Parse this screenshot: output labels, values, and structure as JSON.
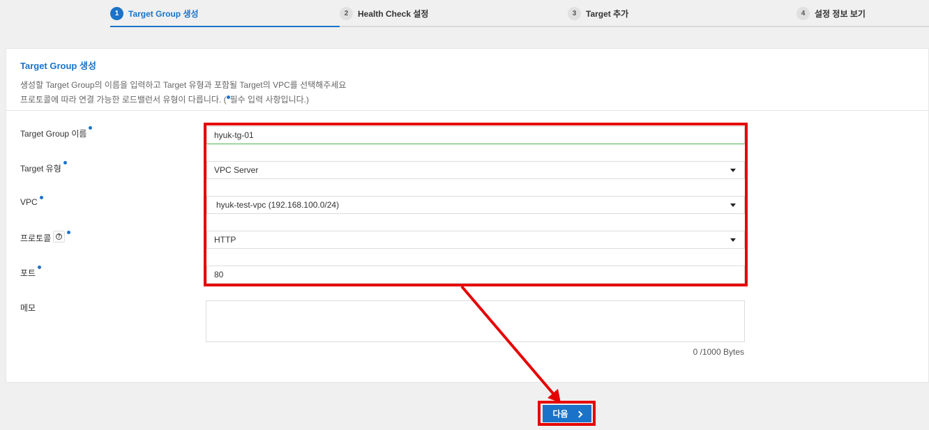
{
  "stepper": {
    "steps": [
      {
        "num": "1",
        "label": "Target Group 생성"
      },
      {
        "num": "2",
        "label": "Health Check 설정"
      },
      {
        "num": "3",
        "label": "Target 추가"
      },
      {
        "num": "4",
        "label": "설정 정보 보기"
      }
    ]
  },
  "panel": {
    "title": "Target Group 생성",
    "desc_line1": "생성할 Target Group의 이름을 입력하고 Target 유형과 포함될 Target의 VPC를 선택해주세요",
    "desc_line2_prefix": "프로토콜에 따라 연결 가능한 로드밸런서 유형이 다릅니다. (",
    "desc_line2_suffix": "필수 입력 사항입니다.)"
  },
  "form": {
    "name_label": "Target Group 이름",
    "name_value": "hyuk-tg-01",
    "type_label": "Target 유형",
    "type_value": "VPC Server",
    "vpc_label": "VPC",
    "vpc_value": "hyuk-test-vpc (192.168.100.0/24)",
    "protocol_label": "프로토콜",
    "protocol_value": "HTTP",
    "port_label": "포트",
    "port_value": "80",
    "memo_label": "메모",
    "memo_value": "",
    "byte_count": "0 /1000 Bytes"
  },
  "footer": {
    "next_label": "다음"
  },
  "colors": {
    "accent": "#1a73c8",
    "highlight": "#e60000",
    "active_field_border": "#4caf50"
  }
}
